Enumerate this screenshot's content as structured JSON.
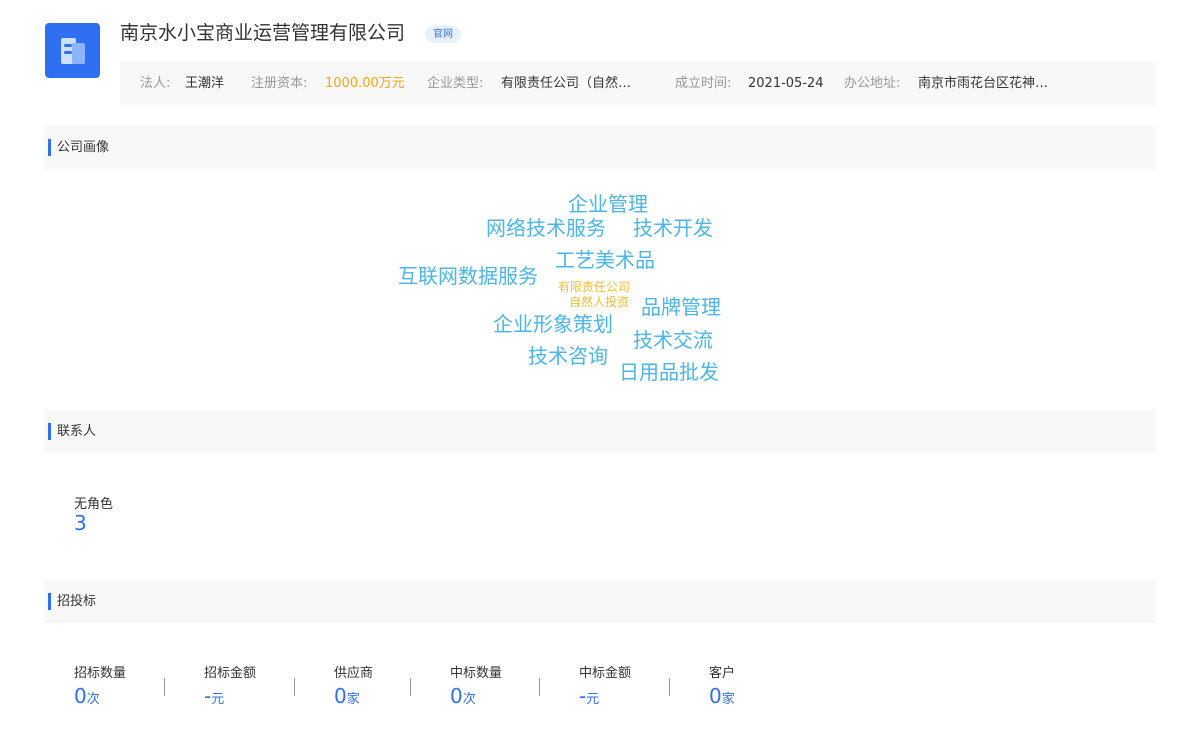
{
  "header": {
    "company_name": "南京水小宝商业运营管理有限公司",
    "official_badge": "官网",
    "logo_icon": "building-icon"
  },
  "info": {
    "legal_label": "法人:",
    "legal_value": "王潮洋",
    "capital_label": "注册资本:",
    "capital_value": "1000.00万元",
    "type_label": "企业类型:",
    "type_value": "有限责任公司（自然…",
    "date_label": "成立时间:",
    "date_value": "2021-05-24",
    "address_label": "办公地址:",
    "address_value": "南京市雨花台区花神…"
  },
  "portrait": {
    "title": "公司画像",
    "words": [
      "企业管理",
      "网络技术服务",
      "技术开发",
      "工艺美术品",
      "互联网数据服务",
      "有限责任公司",
      "自然人投资",
      "品牌管理",
      "企业形象策划",
      "技术交流",
      "技术咨询",
      "日用品批发"
    ]
  },
  "contacts": {
    "title": "联系人",
    "role_label": "无角色",
    "role_count": "3"
  },
  "bidding": {
    "title": "招投标",
    "stats": [
      {
        "label": "招标数量",
        "value": "0",
        "unit": "次"
      },
      {
        "label": "招标金额",
        "value": "-",
        "unit": "元"
      },
      {
        "label": "供应商",
        "value": "0",
        "unit": "家"
      },
      {
        "label": "中标数量",
        "value": "0",
        "unit": "次"
      },
      {
        "label": "中标金额",
        "value": "-",
        "unit": "元"
      },
      {
        "label": "客户",
        "value": "0",
        "unit": "家"
      }
    ]
  },
  "colors": {
    "accent_blue": "#2f6ff1",
    "cloud_blue": "#4ab6ec",
    "cloud_yellow": "#f5bd2e",
    "money_orange": "#f3a712"
  }
}
